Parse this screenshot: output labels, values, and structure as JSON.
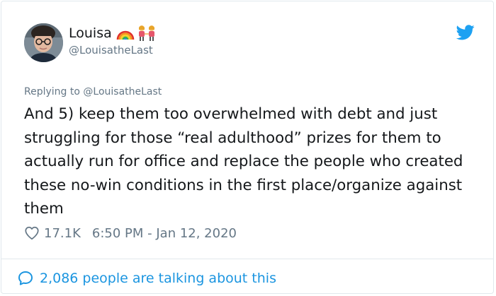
{
  "user": {
    "display_name": "Louisa",
    "handle": "@LouisatheLast",
    "badges": [
      "rainbow-emoji",
      "women-holding-hands-emoji"
    ]
  },
  "tweet": {
    "reply_prefix": "Replying to ",
    "reply_handle": "@LouisatheLast",
    "text": "And 5) keep them too overwhelmed with debt and just struggling for those “real adulthood” prizes for them to actually run for office and replace the people who created these no-win conditions in the first place/organize against them",
    "likes": "17.1K",
    "timestamp": "6:50 PM - Jan 12, 2020"
  },
  "footer": {
    "talking": "2,086 people are talking about this"
  },
  "colors": {
    "text": "#14171a",
    "secondary": "#657786",
    "link": "#1b95e0",
    "twitter_blue": "#1da1f2",
    "border": "#e1e8ed"
  },
  "icons": [
    "avatar",
    "rainbow-icon",
    "women-holding-hands-icon",
    "twitter-bird-icon",
    "heart-icon",
    "speech-bubble-icon"
  ]
}
